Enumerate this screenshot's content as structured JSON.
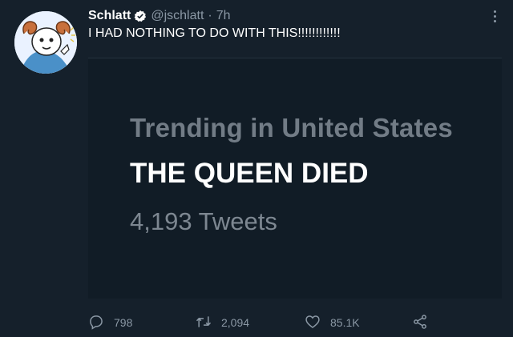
{
  "tweet": {
    "author_name": "Schlatt",
    "handle": "@jschlatt",
    "separator": "·",
    "time": "7h",
    "text": "I HAD NOTHING TO DO WITH THIS!!!!!!!!!!!!",
    "verified": true
  },
  "media": {
    "trend_label": "Trending in United States",
    "topic": "THE QUEEN DIED",
    "tweet_count": "4,193 Tweets"
  },
  "actions": {
    "replies": "798",
    "retweets": "2,094",
    "likes": "85.1K"
  },
  "colors": {
    "background": "#15202b",
    "muted_text": "#8b98a5",
    "verified_blue": "#1d9bf0"
  },
  "icons": [
    "verified-badge-icon",
    "more-icon",
    "reply-icon",
    "retweet-icon",
    "like-icon",
    "share-icon"
  ]
}
